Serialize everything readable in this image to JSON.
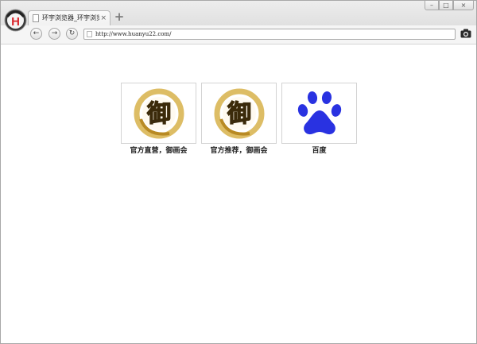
{
  "browser": {
    "tab_title": "环宇浏览器_环宇浏览器",
    "tab_close": "×",
    "new_tab": "+",
    "address": "http://www.huanyu22.com/",
    "window_controls": {
      "minimize": "–",
      "maximize": "□",
      "close": "×"
    },
    "nav": {
      "back": "←",
      "forward": "→",
      "reload": "↻"
    },
    "logo_letter": "H"
  },
  "speed_dial": [
    {
      "label": "官方直营，御画会",
      "icon": "yu-calligraphy-icon",
      "glyph": "御"
    },
    {
      "label": "官方推荐，御画会",
      "icon": "yu-calligraphy-icon",
      "glyph": "御"
    },
    {
      "label": "百度",
      "icon": "baidu-paw-icon"
    }
  ],
  "colors": {
    "baidu_blue": "#2932e1",
    "gold": "#c9a33a",
    "logo_red": "#d8262c"
  }
}
